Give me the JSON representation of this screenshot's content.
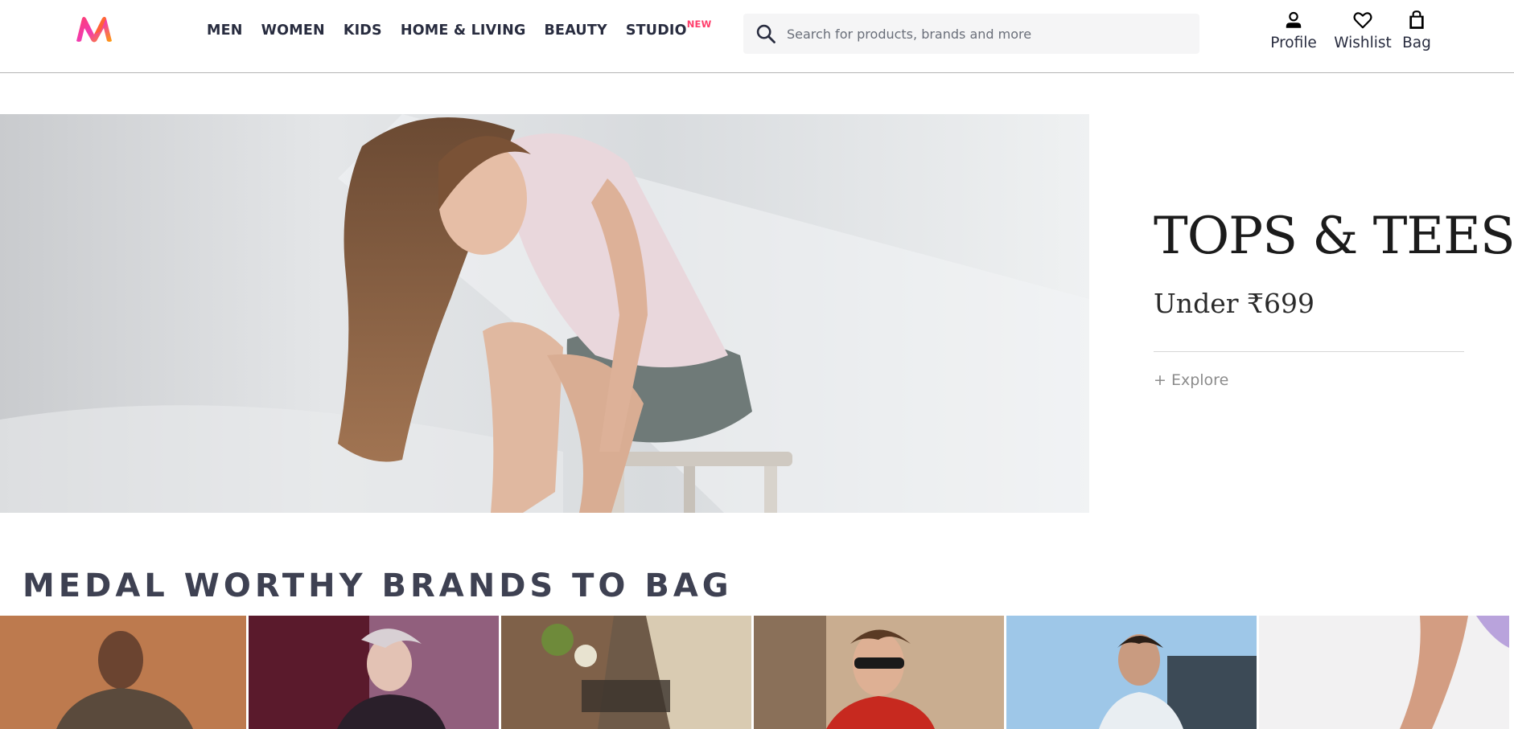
{
  "app": {
    "name": "Myntra"
  },
  "header": {
    "logo_icon": "myntra-m-logo",
    "nav": [
      {
        "label": "MEN"
      },
      {
        "label": "WOMEN"
      },
      {
        "label": "KIDS"
      },
      {
        "label": "HOME & LIVING"
      },
      {
        "label": "BEAUTY"
      },
      {
        "label": "STUDIO",
        "badge": "NEW"
      }
    ],
    "search": {
      "placeholder": "Search for products, brands and more",
      "value": "",
      "icon": "search-icon"
    },
    "actions": [
      {
        "label": "Profile",
        "icon": "profile-icon"
      },
      {
        "label": "Wishlist",
        "icon": "heart-icon"
      },
      {
        "label": "Bag",
        "icon": "bag-icon"
      }
    ]
  },
  "hero": {
    "title": "TOPS & TEES",
    "subtitle": "Under ₹699",
    "cta": "+ Explore"
  },
  "brands_section": {
    "title": "MEDAL WORTHY BRANDS TO BAG",
    "tile_count_visible": 6
  },
  "colors": {
    "brand_pink": "#ff3f6c",
    "text_primary": "#282c3f",
    "section_title": "#3e4152",
    "search_bg": "#f5f5f6"
  }
}
